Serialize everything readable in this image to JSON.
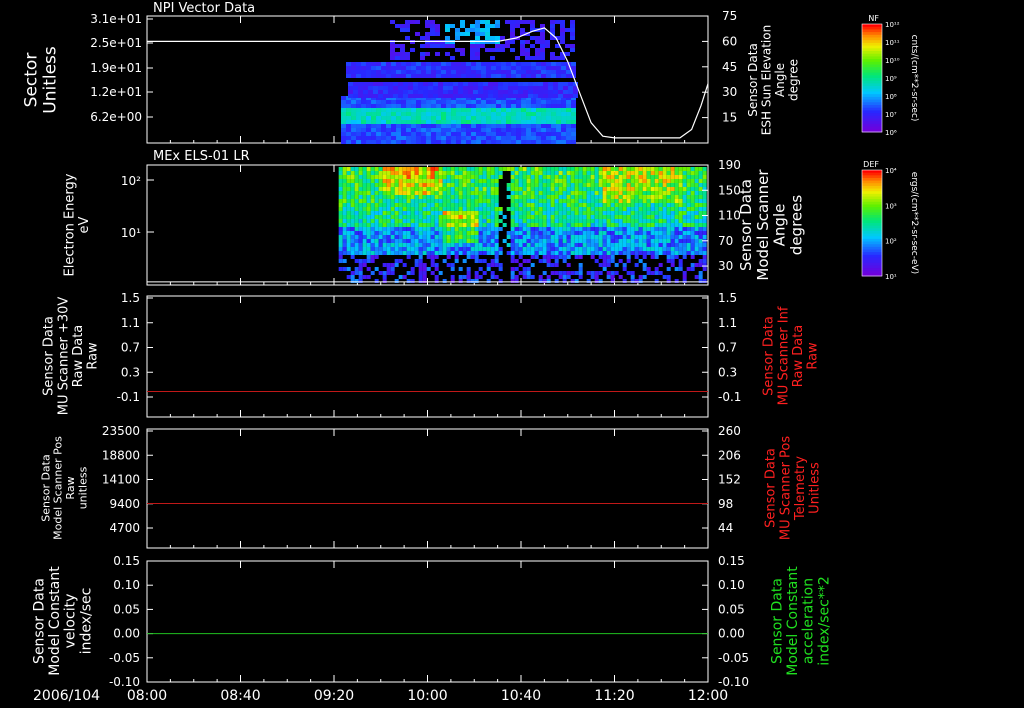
{
  "chart_data": [
    {
      "type": "heatmap",
      "title": "NPI Vector Data",
      "ylabel_left": [
        "Sector",
        "Unitless"
      ],
      "yticks_left": [
        "3.1e+01",
        "2.5e+01",
        "1.9e+01",
        "1.2e+01",
        "6.2e+00"
      ],
      "ylabel_right": [
        "Sensor Data",
        "ESH Sun Elevation",
        "Angle",
        "degree"
      ],
      "yticks_right": [
        "75",
        "60",
        "45",
        "30",
        "15"
      ],
      "yrange_right": [
        0,
        75
      ],
      "colorbar": {
        "tag": "NF",
        "label": "cnts/(cm**2-sr-sec)",
        "ticks": [
          "10¹²",
          "10¹¹",
          "10¹⁰",
          "10⁹",
          "10⁸",
          "10⁷",
          "10⁶"
        ]
      },
      "data_time_range": [
        "09:23",
        "11:03"
      ],
      "overlay_line": {
        "name": "ESH Sun Elevation Angle",
        "x": [
          "08:00",
          "10:30",
          "10:38",
          "10:45",
          "10:50",
          "10:55",
          "11:00",
          "11:05",
          "11:10",
          "11:15",
          "11:20",
          "11:35",
          "11:48",
          "11:53",
          "11:57",
          "12:00"
        ],
        "y": [
          60,
          60,
          62,
          66,
          68,
          62,
          48,
          30,
          12,
          4,
          3,
          3,
          3,
          8,
          22,
          35
        ]
      }
    },
    {
      "type": "heatmap",
      "title": "MEx ELS-01 LR",
      "ylabel_left": [
        "Electron Energy",
        "eV"
      ],
      "yticks_left": [
        "10²",
        "10¹"
      ],
      "ylabel_right": [
        "Sensor Data",
        "Model Scanner",
        "Angle",
        "degrees"
      ],
      "yticks_right": [
        "190",
        "150",
        "110",
        "70",
        "30"
      ],
      "yrange_right": [
        0,
        190
      ],
      "colorbar": {
        "tag": "DEF",
        "label": "ergs/(cm**2-sr-sec-eV)",
        "ticks": [
          "10⁴",
          "10³",
          "10²",
          "10¹"
        ]
      },
      "data_time_range": [
        "09:22",
        "12:00"
      ],
      "gap_time_range": [
        "10:30",
        "10:34"
      ],
      "overlay_line": {
        "name": "Model Scanner Angle",
        "x": [
          "08:00",
          "12:00"
        ],
        "y": [
          5,
          5
        ]
      }
    },
    {
      "type": "line",
      "ylabel_left": [
        "Sensor Data",
        "MU Scanner +30V",
        "Raw Data",
        "Raw"
      ],
      "yticks_left": [
        "1.5",
        "1.1",
        "0.7",
        "0.3",
        "-0.1"
      ],
      "yrange_left": [
        -0.4,
        1.5
      ],
      "ylabel_right": [
        "Sensor Data",
        "MU Scanner Inf",
        "Raw Data",
        "Raw"
      ],
      "yticks_right": [
        "1.5",
        "1.1",
        "0.7",
        "0.3",
        "-0.1"
      ],
      "series": [
        {
          "x": [
            "08:00",
            "12:00"
          ],
          "y": [
            0.0,
            0.0
          ]
        }
      ]
    },
    {
      "type": "line",
      "ylabel_left": [
        "Sensor Data",
        "Model Scanner Pos",
        "Raw",
        "unitless"
      ],
      "yticks_left": [
        "23500",
        "18800",
        "14100",
        "9400",
        "4700"
      ],
      "yrange_left": [
        0,
        23500
      ],
      "ylabel_right": [
        "Sensor Data",
        "MU Scanner Pos",
        "Telemetry",
        "Unitless"
      ],
      "yticks_right": [
        "260",
        "206",
        "152",
        "98",
        "44"
      ],
      "series": [
        {
          "x": [
            "08:00",
            "12:00"
          ],
          "y": [
            8800,
            8800
          ]
        }
      ]
    },
    {
      "type": "line",
      "ylabel_left": [
        "Sensor Data",
        "Model Constant",
        "velocity",
        "index/sec"
      ],
      "yticks_left": [
        "0.15",
        "0.10",
        "0.05",
        "0.00",
        "-0.05",
        "-0.10"
      ],
      "yrange_left": [
        -0.1,
        0.15
      ],
      "ylabel_right": [
        "Sensor Data",
        "Model Constant",
        "acceleration",
        "index/sec**2"
      ],
      "yticks_right": [
        "0.15",
        "0.10",
        "0.05",
        "0.00",
        "-0.05",
        "-0.10"
      ],
      "series": [
        {
          "x": [
            "08:00",
            "12:00"
          ],
          "y": [
            0.0,
            0.0
          ]
        }
      ]
    }
  ],
  "time_axis": {
    "date_label": "2006/104",
    "ticks": [
      "08:00",
      "08:40",
      "09:20",
      "10:00",
      "10:40",
      "11:20",
      "12:00"
    ],
    "start": "08:00",
    "end": "12:00"
  },
  "colors": {
    "background": "#000000",
    "axes": "#ffffff",
    "panel3_right_label": "#ff2020",
    "panel3_line": "#c01818",
    "panel4_right_label": "#ff2020",
    "panel4_line": "#c01818",
    "panel5_right_label": "#20e020",
    "panel5_line": "#20c020"
  }
}
